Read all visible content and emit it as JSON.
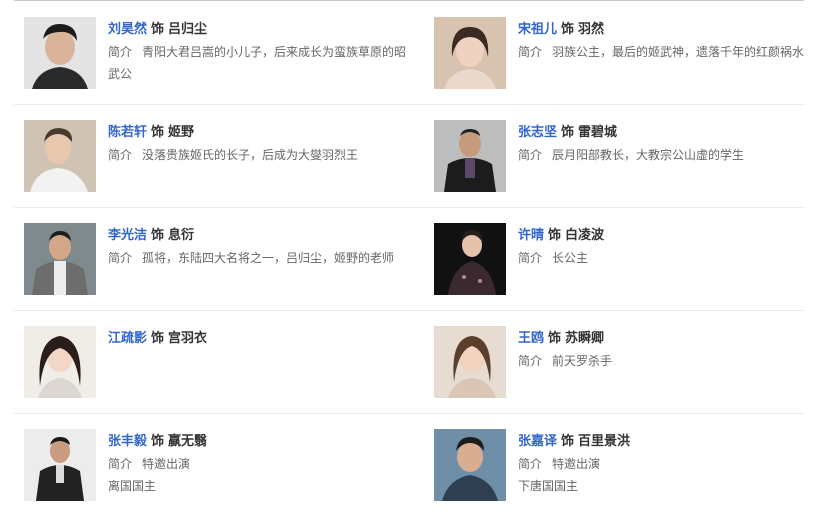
{
  "cast_list": {
    "desc_label": "简介",
    "as_word": "饰",
    "cards": [
      {
        "actor": "刘昊然",
        "role": "吕归尘",
        "desc": "青阳大君吕嵩的小儿子，后来成长为蛮族草原的昭武公",
        "extra": ""
      },
      {
        "actor": "宋祖儿",
        "role": "羽然",
        "desc": "羽族公主，最后的姬武神，遗落千年的红颜祸水",
        "extra": ""
      },
      {
        "actor": "陈若轩",
        "role": "姬野",
        "desc": "没落贵族姬氏的长子，后成为大燮羽烈王",
        "extra": ""
      },
      {
        "actor": "张志坚",
        "role": "雷碧城",
        "desc": "辰月阳部教长，大教宗公山虚的学生",
        "extra": ""
      },
      {
        "actor": "李光洁",
        "role": "息衍",
        "desc": "孤将，东陆四大名将之一，吕归尘，姬野的老师",
        "extra": ""
      },
      {
        "actor": "许晴",
        "role": "白凌波",
        "desc": "长公主",
        "extra": ""
      },
      {
        "actor": "江疏影",
        "role": "宫羽衣",
        "desc": "",
        "extra": ""
      },
      {
        "actor": "王鸥",
        "role": "苏瞬卿",
        "desc": "前天罗杀手",
        "extra": ""
      },
      {
        "actor": "张丰毅",
        "role": "嬴无翳",
        "desc": "特邀出演",
        "extra": "离国国主"
      },
      {
        "actor": "张嘉译",
        "role": "百里景洪",
        "desc": "特邀出演",
        "extra": "下唐国国主"
      }
    ]
  },
  "colors": {
    "actor_link": "#3366cc",
    "role_text": "#333333",
    "desc_text": "#666666",
    "separator": "#ececec"
  }
}
